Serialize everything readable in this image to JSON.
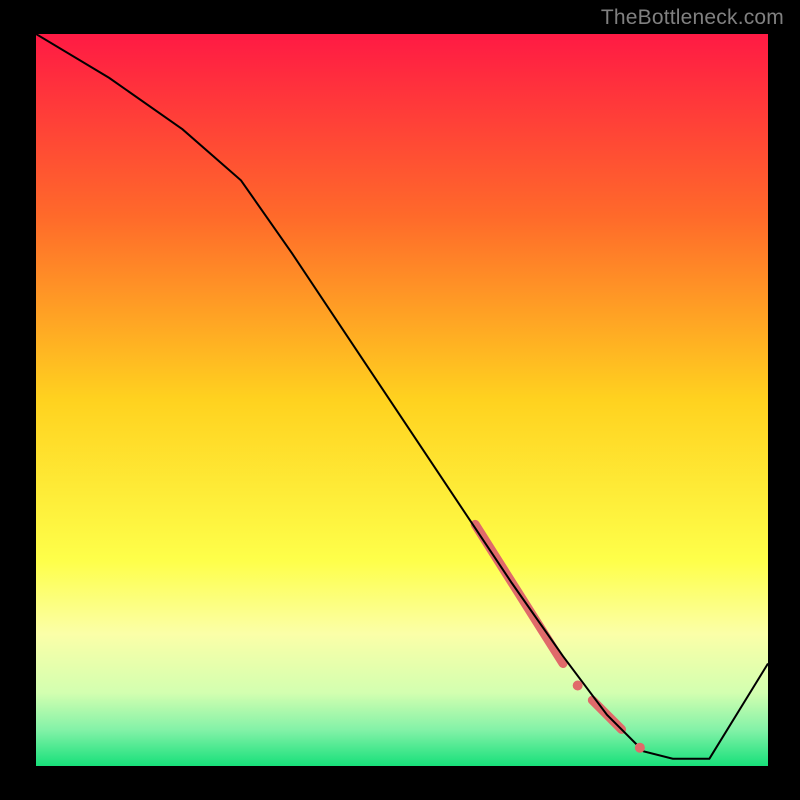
{
  "watermark": "TheBottleneck.com",
  "chart_data": {
    "type": "line",
    "title": "",
    "xlabel": "",
    "ylabel": "",
    "xlim": [
      0,
      100
    ],
    "ylim": [
      0,
      100
    ],
    "grid": false,
    "background": {
      "type": "vertical-gradient",
      "stops": [
        {
          "pos": 0.0,
          "color": "#ff1a44"
        },
        {
          "pos": 0.25,
          "color": "#ff6a2a"
        },
        {
          "pos": 0.5,
          "color": "#ffd21f"
        },
        {
          "pos": 0.72,
          "color": "#feff4a"
        },
        {
          "pos": 0.82,
          "color": "#fbffa8"
        },
        {
          "pos": 0.9,
          "color": "#d3ffb0"
        },
        {
          "pos": 0.95,
          "color": "#84f2a8"
        },
        {
          "pos": 1.0,
          "color": "#17e07a"
        }
      ]
    },
    "series": [
      {
        "name": "curve",
        "color": "#000000",
        "width": 2,
        "x": [
          0,
          10,
          20,
          28,
          35,
          45,
          55,
          65,
          72,
          78,
          83,
          87,
          92,
          100
        ],
        "y": [
          100,
          94,
          87,
          80,
          70,
          55,
          40,
          25,
          15,
          7,
          2,
          1,
          1,
          14
        ]
      }
    ],
    "highlight_segments": [
      {
        "color": "#e06a6a",
        "width": 9,
        "x": [
          60,
          72
        ],
        "y": [
          33,
          14
        ]
      },
      {
        "color": "#e06a6a",
        "width": 9,
        "x": [
          76,
          80
        ],
        "y": [
          9,
          5
        ]
      }
    ],
    "highlight_points": [
      {
        "color": "#e06a6a",
        "r": 5,
        "x": 74,
        "y": 11
      },
      {
        "color": "#e06a6a",
        "r": 5,
        "x": 82.5,
        "y": 2.5
      }
    ]
  }
}
